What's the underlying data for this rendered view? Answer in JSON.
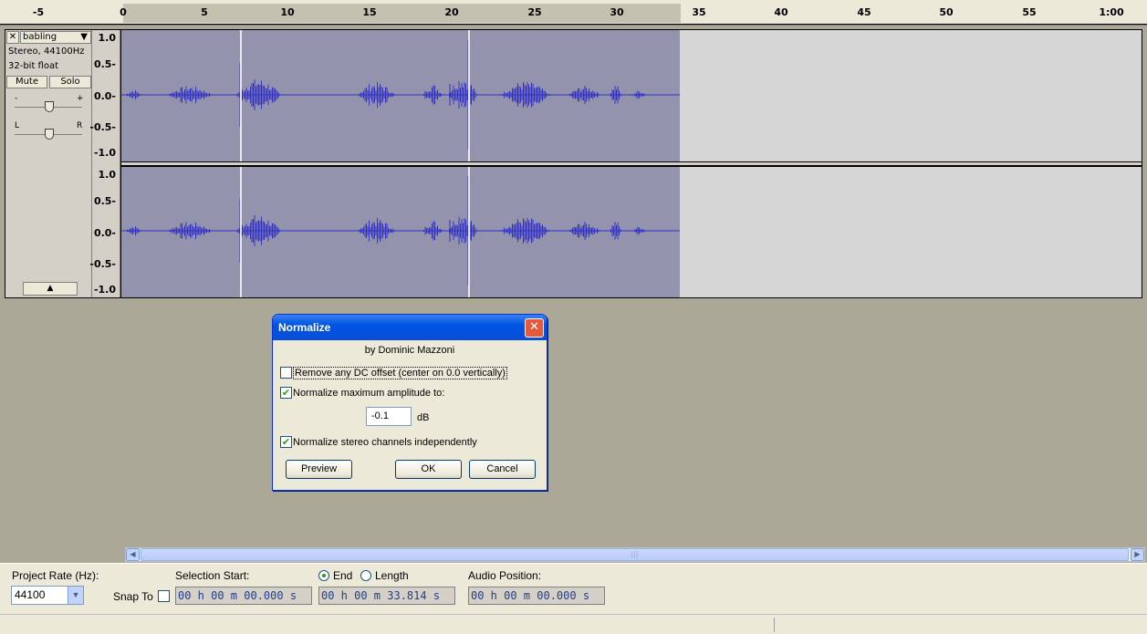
{
  "ruler": {
    "ticks": [
      "-5",
      "0",
      "5",
      "10",
      "15",
      "20",
      "25",
      "30",
      "35",
      "40",
      "45",
      "50",
      "55",
      "1:00"
    ]
  },
  "track": {
    "name": "babling",
    "format": "Stereo, 44100Hz",
    "bit_depth": "32-bit float",
    "mute_label": "Mute",
    "solo_label": "Solo",
    "gain_minus": "-",
    "gain_plus": "+",
    "pan_left": "L",
    "pan_right": "R",
    "scale_labels": [
      "1.0",
      "0.5-",
      "0.0-",
      "-0.5-",
      "-1.0"
    ]
  },
  "dialog": {
    "title": "Normalize",
    "author": "by Dominic Mazzoni",
    "dc_offset_label": "Remove any DC offset (center on 0.0 vertically)",
    "dc_offset_checked": false,
    "normalize_label": "Normalize maximum amplitude to:",
    "normalize_checked": true,
    "amplitude_value": "-0.1",
    "amplitude_unit": "dB",
    "stereo_label": "Normalize stereo channels independently",
    "stereo_checked": true,
    "preview_label": "Preview",
    "ok_label": "OK",
    "cancel_label": "Cancel"
  },
  "selection_bar": {
    "project_rate_label": "Project Rate (Hz):",
    "project_rate_value": "44100",
    "snap_to_label": "Snap To",
    "selection_start_label": "Selection Start:",
    "end_label": "End",
    "length_label": "Length",
    "end_selected": true,
    "audio_position_label": "Audio Position:",
    "selection_start": "00 h 00 m 00.000 s",
    "selection_end": "00 h 00 m 33.814 s",
    "audio_position": "00 h 00 m 00.000 s"
  },
  "colors": {
    "waveform": "#3232c8",
    "selection": "#9393ad",
    "titlebar": "#0054e3"
  }
}
